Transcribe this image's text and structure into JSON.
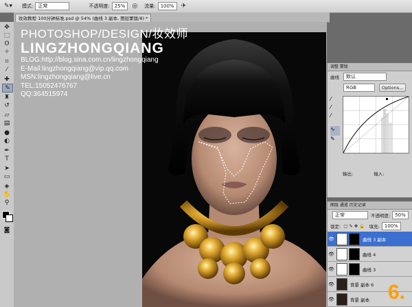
{
  "options_bar": {
    "mode_label": "模式:",
    "mode_value": "正常",
    "opacity_label": "不透明度:",
    "opacity_value": "25%",
    "flow_label": "流量:",
    "flow_value": "100%"
  },
  "document_tab": "妆效教程 100分钟标准.psd @ 54% (曲线 3 副本, 图层蒙版/8) *",
  "watermark": {
    "line1": "PHOTOSHOP/DESIGN/妆效师",
    "line2": "LINGZHONGQIANG",
    "blog": "BLOG:http://blog.sina.com.cn/lingzhongqiang",
    "email": "E-Mail:lingzhongqiang@vip.qq.com",
    "msn": "MSN:lingzhongqiang@live.cn",
    "tel": "TEL:15052476767",
    "qq": "QQ:364515974"
  },
  "adjustments_panel": {
    "tabs": "调整  蒙版",
    "preset_label": "曲线",
    "preset_value": "默认",
    "channel": "RGB",
    "options_button": "Options...",
    "output_label": "输出:",
    "input_label": "输入:"
  },
  "layers_panel": {
    "tabs": "图层  通道  历史记录",
    "blend_mode": "正常",
    "opacity_label": "不透明度:",
    "opacity_value": "50%",
    "lock_label": "锁定:",
    "fill_label": "填充:",
    "fill_value": "100%",
    "layers": [
      {
        "name": "曲线 3 副本",
        "selected": true
      },
      {
        "name": "曲线 4",
        "selected": false
      },
      {
        "name": "曲线 3",
        "selected": false
      },
      {
        "name": "背景 副本 6",
        "selected": false
      },
      {
        "name": "背景 副本",
        "selected": false
      }
    ]
  },
  "step_badge": "6.",
  "colors": {
    "accent": "#ff9e00",
    "selection": "#3d6fd0"
  }
}
